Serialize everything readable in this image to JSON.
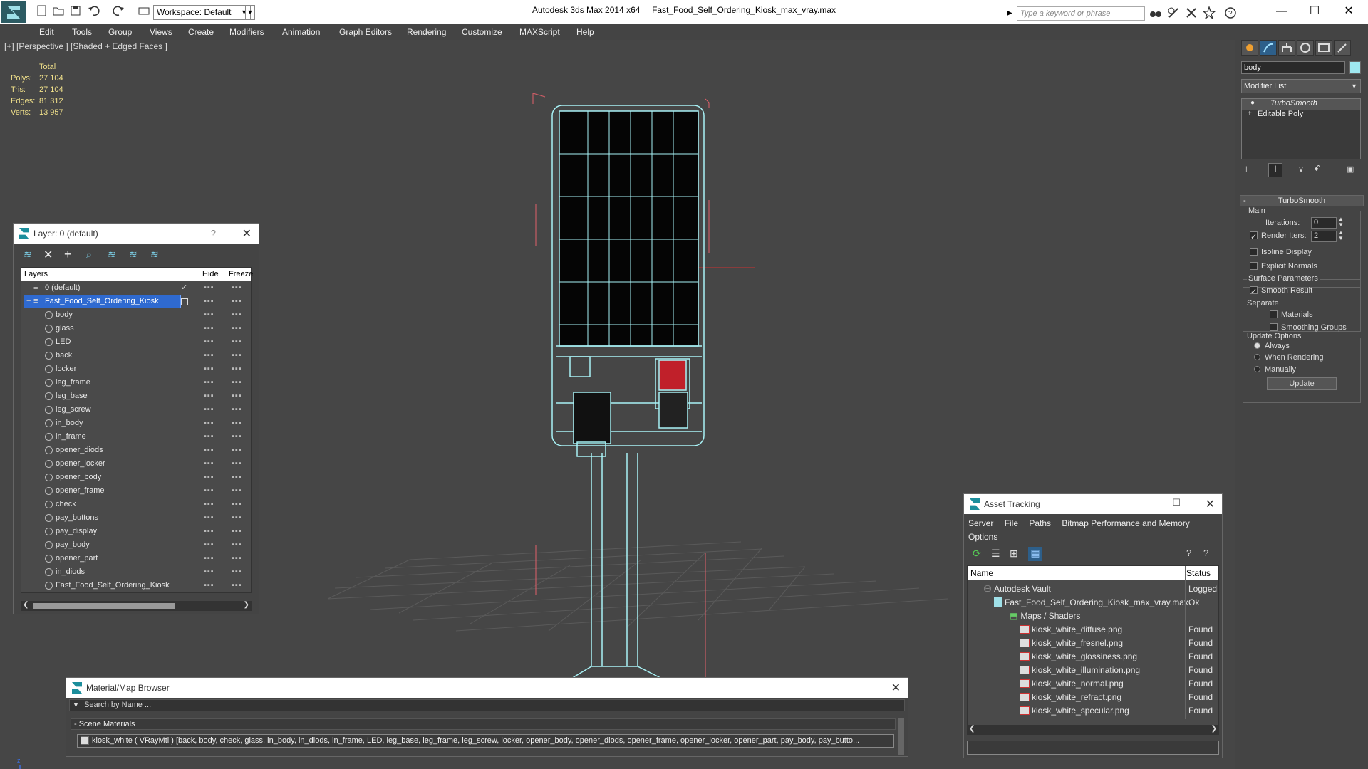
{
  "titlebar": {
    "workspace": "Workspace: Default",
    "app_name": "Autodesk 3ds Max  2014 x64",
    "file_name": "Fast_Food_Self_Ordering_Kiosk_max_vray.max",
    "search_placeholder": "Type a keyword or phrase"
  },
  "menu": [
    "Edit",
    "Tools",
    "Group",
    "Views",
    "Create",
    "Modifiers",
    "Animation",
    "Graph Editors",
    "Rendering",
    "Customize",
    "MAXScript",
    "Help"
  ],
  "viewport": {
    "label": "[+] [Perspective ] [Shaded + Edged Faces ]",
    "stats_header": "Total",
    "stats": [
      {
        "label": "Polys:",
        "value": "27 104"
      },
      {
        "label": "Tris:",
        "value": "27 104"
      },
      {
        "label": "Edges:",
        "value": "81 312"
      },
      {
        "label": "Verts:",
        "value": "13 957"
      }
    ]
  },
  "layers_window": {
    "title": "Layer: 0 (default)",
    "help": "?",
    "col_layers": "Layers",
    "col_hide": "Hide",
    "col_freeze": "Freeze",
    "default_layer": "0 (default)",
    "selected_layer": "Fast_Food_Self_Ordering_Kiosk",
    "objects": [
      "body",
      "glass",
      "LED",
      "back",
      "locker",
      "leg_frame",
      "leg_base",
      "leg_screw",
      "in_body",
      "in_frame",
      "opener_diods",
      "opener_locker",
      "opener_body",
      "opener_frame",
      "check",
      "pay_buttons",
      "pay_display",
      "pay_body",
      "opener_part",
      "in_diods",
      "Fast_Food_Self_Ordering_Kiosk"
    ]
  },
  "command_panel": {
    "object_name": "body",
    "modifier_list": "Modifier List",
    "stack": [
      "TurboSmooth",
      "Editable Poly"
    ],
    "rollout_title": "TurboSmooth",
    "main_group": "Main",
    "iterations_label": "Iterations:",
    "iterations_value": "0",
    "render_iters_label": "Render Iters:",
    "render_iters_value": "2",
    "isoline": "Isoline Display",
    "explicit_normals": "Explicit Normals",
    "surface_params": "Surface Parameters",
    "smooth_result": "Smooth Result",
    "separate": "Separate",
    "materials": "Materials",
    "smoothing_groups": "Smoothing Groups",
    "update_options": "Update Options",
    "always": "Always",
    "when_rendering": "When Rendering",
    "manually": "Manually",
    "update_btn": "Update"
  },
  "asset_tracking": {
    "title": "Asset Tracking",
    "menus": [
      "Server",
      "File",
      "Paths",
      "Bitmap Performance and Memory",
      "Options"
    ],
    "col_name": "Name",
    "col_status": "Status",
    "rows": [
      {
        "name": "Autodesk Vault",
        "status": "Logged",
        "indent": 1,
        "icon": "vault"
      },
      {
        "name": "Fast_Food_Self_Ordering_Kiosk_max_vray.max",
        "status": "Ok",
        "indent": 2,
        "icon": "max"
      },
      {
        "name": "Maps / Shaders",
        "status": "",
        "indent": 3,
        "icon": "maps"
      },
      {
        "name": "kiosk_white_diffuse.png",
        "status": "Found",
        "indent": 4,
        "icon": "png"
      },
      {
        "name": "kiosk_white_fresnel.png",
        "status": "Found",
        "indent": 4,
        "icon": "png"
      },
      {
        "name": "kiosk_white_glossiness.png",
        "status": "Found",
        "indent": 4,
        "icon": "png"
      },
      {
        "name": "kiosk_white_illumination.png",
        "status": "Found",
        "indent": 4,
        "icon": "png"
      },
      {
        "name": "kiosk_white_normal.png",
        "status": "Found",
        "indent": 4,
        "icon": "png"
      },
      {
        "name": "kiosk_white_refract.png",
        "status": "Found",
        "indent": 4,
        "icon": "png"
      },
      {
        "name": "kiosk_white_specular.png",
        "status": "Found",
        "indent": 4,
        "icon": "png"
      }
    ]
  },
  "material_browser": {
    "title": "Material/Map Browser",
    "search_placeholder": "Search by Name ...",
    "group": "- Scene Materials",
    "item": "kiosk_white ( VRayMtl ) [back, body, check, glass, in_body, in_diods, in_frame, LED, leg_base, leg_frame, leg_screw, locker, opener_body, opener_diods, opener_frame, opener_locker, opener_part, pay_body, pay_butto..."
  }
}
